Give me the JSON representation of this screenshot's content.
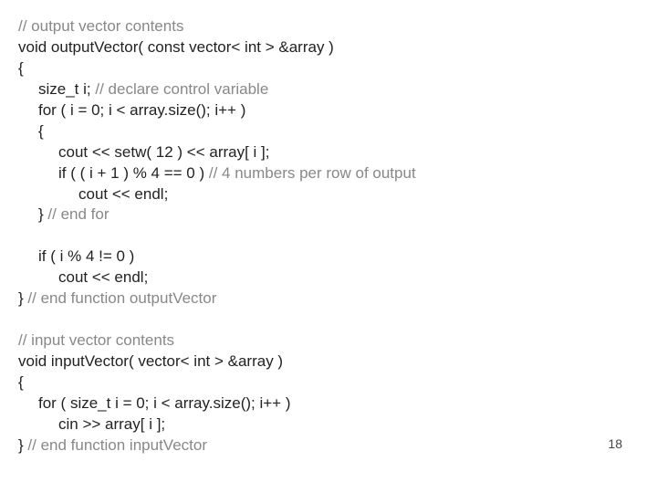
{
  "page_number": "18",
  "code": {
    "l1_comment": "// output vector contents",
    "l2_a": "void outputVector( const vector< int > &array )",
    "l3": "{",
    "l4_a": "size_t i; ",
    "l4_b_comment": "// declare control variable",
    "l5": "for ( i = 0; i < array.size(); i++ )",
    "l6": "{",
    "l7": "cout << setw( 12 ) << array[ i ];",
    "l8_a": "if ( ( i + 1 ) % 4 == 0 ) ",
    "l8_b_comment": "// 4 numbers per row of output",
    "l9": "cout << endl;",
    "l10_a": "} ",
    "l10_b_comment": "// end for",
    "l11": "",
    "l12": "if ( i % 4 != 0 )",
    "l13": "cout << endl;",
    "l14_a": "} ",
    "l14_b_comment": "// end function outputVector",
    "l15": "",
    "l16_comment": "// input vector contents",
    "l17": "void inputVector( vector< int > &array )",
    "l18": "{",
    "l19": "for ( size_t i = 0; i < array.size(); i++ )",
    "l20": "cin >> array[ i ];",
    "l21_a": "} ",
    "l21_b_comment": "// end function inputVector"
  }
}
